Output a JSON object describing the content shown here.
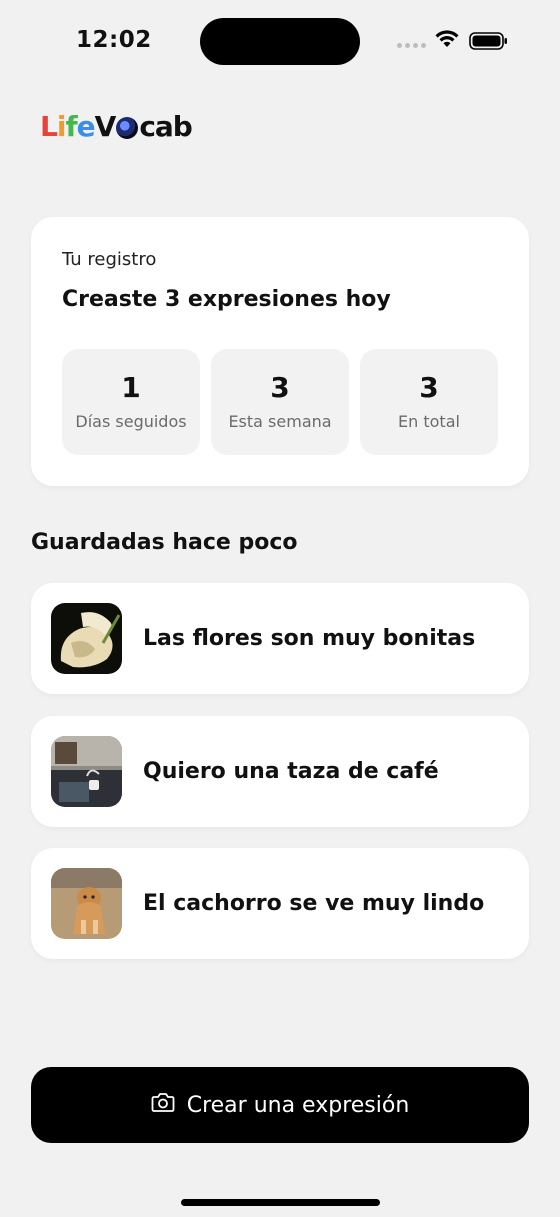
{
  "status_bar": {
    "time": "12:02"
  },
  "logo": {
    "part1": "L",
    "part2": "i",
    "part3": "f",
    "part4": "e",
    "part5": "V",
    "part6": "cab"
  },
  "record": {
    "label": "Tu registro",
    "headline": "Creaste 3 expresiones hoy",
    "stats": [
      {
        "value": "1",
        "label": "Días seguidos"
      },
      {
        "value": "3",
        "label": "Esta semana"
      },
      {
        "value": "3",
        "label": "En total"
      }
    ]
  },
  "recent": {
    "title": "Guardadas hace poco",
    "items": [
      {
        "text": "Las flores son muy bonitas",
        "thumb_icon": "flower-photo"
      },
      {
        "text": "Quiero una taza de café",
        "thumb_icon": "coffee-photo"
      },
      {
        "text": "El cachorro se ve muy lindo",
        "thumb_icon": "puppy-photo"
      }
    ]
  },
  "create_button": {
    "label": "Crear una expresión",
    "icon": "camera-icon"
  }
}
